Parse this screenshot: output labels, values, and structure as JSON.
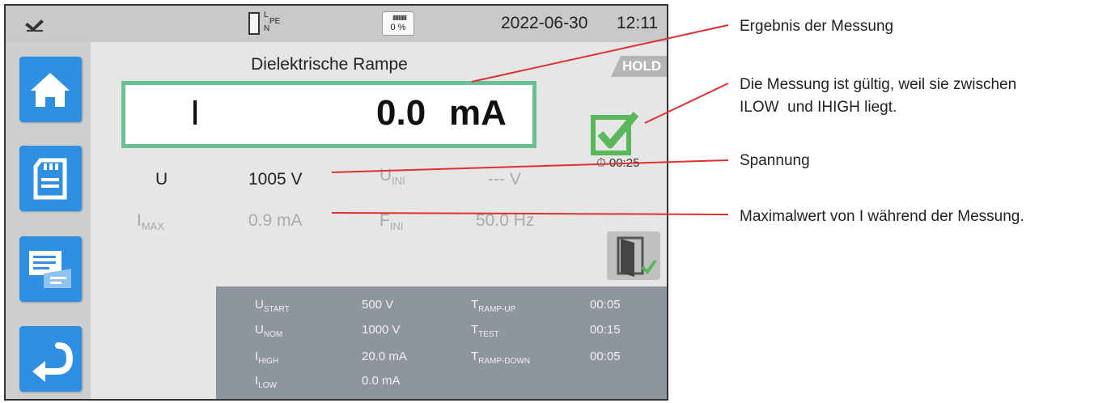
{
  "status_bar": {
    "date": "2022-06-30",
    "time": "12:11",
    "wiring": {
      "l": "L",
      "n": "N",
      "pe": "PE"
    },
    "sd_card_usage": "0 %",
    "connection_icon": "plug-icon"
  },
  "sidebar": {
    "items": [
      {
        "name": "home",
        "icon": "home-icon"
      },
      {
        "name": "memory",
        "icon": "sd-card-icon"
      },
      {
        "name": "messages",
        "icon": "notes-icon"
      },
      {
        "name": "back",
        "icon": "return-icon"
      }
    ],
    "color": "#2f8fe0"
  },
  "main": {
    "title": "Dielektrische Rampe",
    "hold": "HOLD",
    "result": {
      "label": "I",
      "value": "0.0",
      "unit": "mA"
    },
    "timer": "00:25",
    "valid_color": "#5bb75b",
    "u": {
      "label": "U",
      "value": "1005 V"
    },
    "u_ini": {
      "label": "U",
      "sub": "INI",
      "value": "--- V"
    },
    "i_max": {
      "label": "I",
      "sub": "MAX",
      "value": "0.9 mA"
    },
    "f_ini": {
      "label": "F",
      "sub": "INI",
      "value": "50.0 Hz"
    }
  },
  "params": {
    "u_start": {
      "label": "U",
      "sub": "START",
      "value": "500 V"
    },
    "u_nom": {
      "label": "U",
      "sub": "NOM",
      "value": "1000 V"
    },
    "i_high": {
      "label": "I",
      "sub": "HIGH",
      "value": "20.0 mA"
    },
    "i_low": {
      "label": "I",
      "sub": "LOW",
      "value": "0.0 mA"
    },
    "t_ramp_up": {
      "label": "T",
      "sub": "RAMP-UP",
      "value": "00:05"
    },
    "t_test": {
      "label": "T",
      "sub": "TEST",
      "value": "00:15"
    },
    "t_ramp_down": {
      "label": "T",
      "sub": "RAMP-DOWN",
      "value": "00:05"
    }
  },
  "annotations": {
    "result": "Ergebnis der Messung",
    "valid_line1": "Die Messung ist gültig, weil sie zwischen",
    "valid_line2_a": "ILOW",
    "valid_line2_b": "und",
    "valid_line2_c": "IHIGH",
    "valid_line2_d": "liegt.",
    "voltage": "Spannung",
    "max": "Maximalwert von I während der Messung.",
    "line_color": "#e03030"
  }
}
